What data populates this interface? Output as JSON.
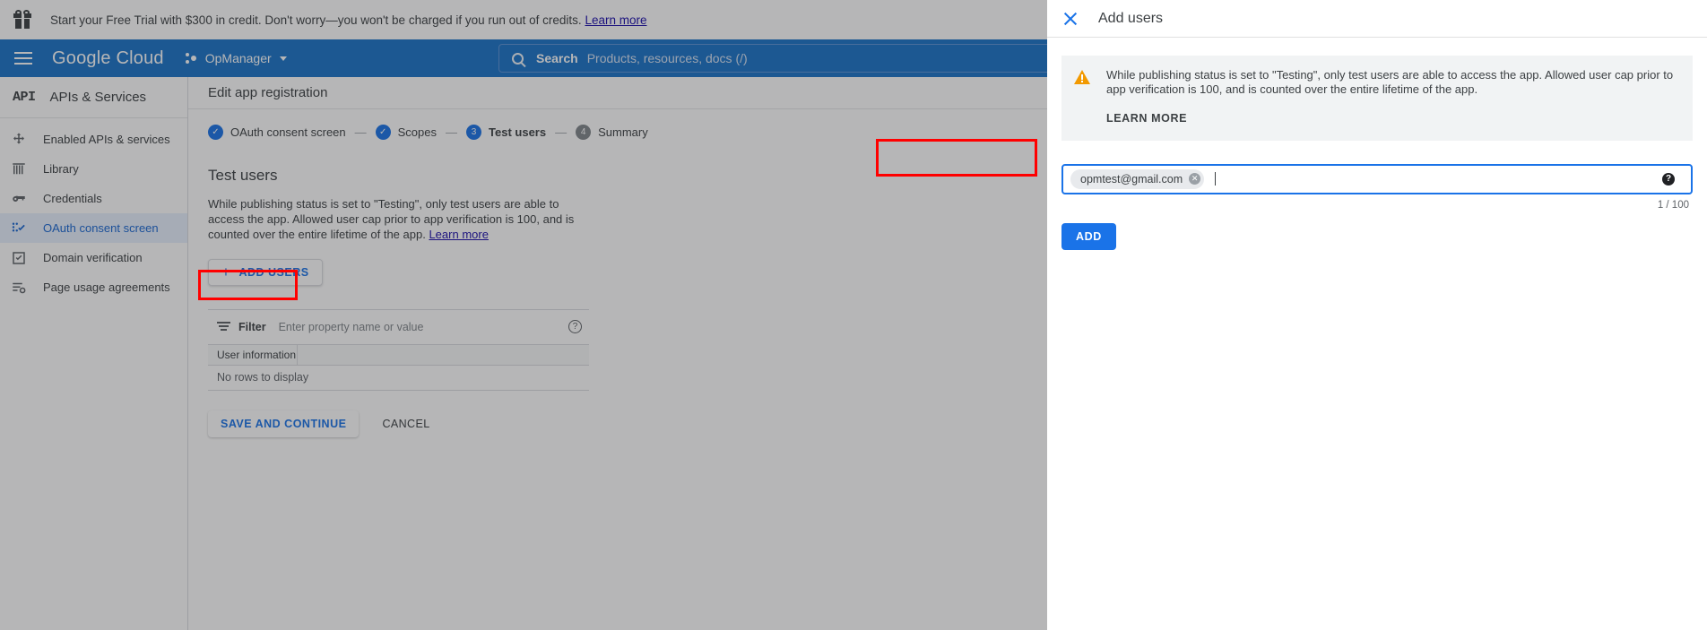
{
  "promo": {
    "icon": "gift-icon",
    "text": "Start your Free Trial with $300 in credit. Don't worry—you won't be charged if you run out of credits.",
    "link": "Learn more"
  },
  "header": {
    "menu_icon": "hamburger-icon",
    "brand_google": "Google",
    "brand_cloud": "Cloud",
    "project_name": "OpManager",
    "project_caret_icon": "chevron-down-icon",
    "search": {
      "icon": "search-icon",
      "label": "Search",
      "placeholder": "Products, resources, docs (/)"
    }
  },
  "sidebar": {
    "logo": "API",
    "title": "APIs & Services",
    "items": [
      {
        "label": "Enabled APIs & services",
        "icon": "dashboard-icon",
        "active": false
      },
      {
        "label": "Library",
        "icon": "library-icon",
        "active": false
      },
      {
        "label": "Credentials",
        "icon": "key-icon",
        "active": false
      },
      {
        "label": "OAuth consent screen",
        "icon": "consent-icon",
        "active": true
      },
      {
        "label": "Domain verification",
        "icon": "checkbox-icon",
        "active": false
      },
      {
        "label": "Page usage agreements",
        "icon": "agreement-icon",
        "active": false
      }
    ]
  },
  "content": {
    "breadcrumb_title": "Edit app registration",
    "stepper": [
      {
        "marker": "✓",
        "label": "OAuth consent screen",
        "state": "done"
      },
      {
        "marker": "✓",
        "label": "Scopes",
        "state": "done"
      },
      {
        "marker": "3",
        "label": "Test users",
        "state": "current"
      },
      {
        "marker": "4",
        "label": "Summary",
        "state": "todo"
      }
    ],
    "step_separator": "—",
    "section_title": "Test users",
    "section_body": "While publishing status is set to \"Testing\", only test users are able to access the app. Allowed user cap prior to app verification is 100, and is counted over the entire lifetime of the app.",
    "section_body_link": "Learn more",
    "add_users_button": "ADD USERS",
    "add_users_plus_icon": "plus-icon",
    "filter": {
      "icon": "filter-icon",
      "label": "Filter",
      "placeholder": "Enter property name or value",
      "help_icon": "help-icon",
      "help_glyph": "?"
    },
    "table": {
      "columns": [
        "User information"
      ],
      "empty_text": "No rows to display"
    },
    "save_button": "SAVE AND CONTINUE",
    "cancel_button": "CANCEL"
  },
  "panel": {
    "close_icon": "close-icon",
    "title": "Add users",
    "warning": {
      "icon": "warning-icon",
      "text": "While publishing status is set to \"Testing\", only test users are able to access the app. Allowed user cap prior to app verification is 100, and is counted over the entire lifetime of the app.",
      "learn_more_button": "LEARN MORE"
    },
    "email_field": {
      "chips": [
        {
          "value": "opmtest@gmail.com",
          "remove_icon": "chip-remove-icon",
          "remove_glyph": "✕"
        }
      ],
      "help_icon": "help-icon",
      "help_glyph": "?",
      "counter": "1 / 100"
    },
    "add_button": "ADD"
  },
  "annotations": [
    {
      "name": "add-users-button-highlight",
      "color": "#ff0000"
    },
    {
      "name": "email-chip-input-highlight",
      "color": "#ff0000"
    }
  ],
  "colors": {
    "header_blue": "#1a73c8",
    "accent_blue": "#1a73e8",
    "link_blue": "#1a0dab",
    "active_nav_bg": "#e8f0fe",
    "warning_orange": "#f29900",
    "annotation_red": "#ff0000"
  }
}
